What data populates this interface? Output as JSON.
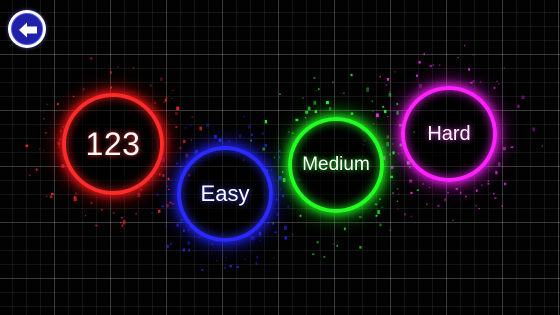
{
  "back_button": {
    "icon": "back-arrow-icon"
  },
  "modes": [
    {
      "label": "123",
      "color": "#ff2a2a"
    },
    {
      "label": "Easy",
      "color": "#2a2aff"
    },
    {
      "label": "Medium",
      "color": "#22ff22"
    },
    {
      "label": "Hard",
      "color": "#ff22ff"
    }
  ]
}
